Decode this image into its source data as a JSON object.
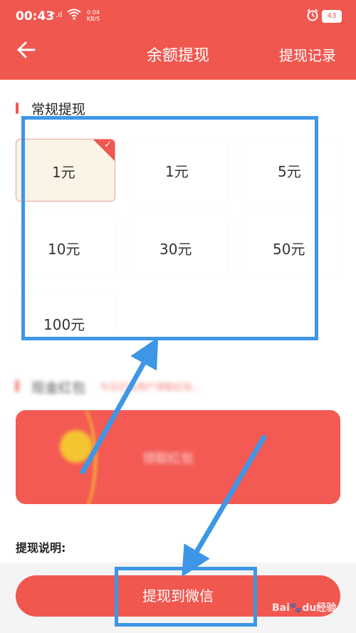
{
  "status_bar": {
    "time": "00:43",
    "signal": "ˣ.ıl",
    "wifi_icon": "wifi-icon",
    "net_speed": "0.04\nKB/S",
    "alarm_icon": "alarm-icon",
    "battery": "43"
  },
  "header": {
    "back_icon": "back-arrow-icon",
    "title": "余额提现",
    "records_label": "提现记录"
  },
  "regular_withdraw": {
    "title": "常规提现",
    "options": [
      {
        "label": "1元",
        "selected": true
      },
      {
        "label": "1元",
        "selected": false
      },
      {
        "label": "5元",
        "selected": false
      },
      {
        "label": "10元",
        "selected": false
      },
      {
        "label": "30元",
        "selected": false
      },
      {
        "label": "50元",
        "selected": false
      },
      {
        "label": "100元",
        "selected": false
      }
    ]
  },
  "cash_redpacket": {
    "title": "现金红包",
    "subtitle": "今日已有用户领取红包…",
    "banner_text": "领取红包"
  },
  "notes_label": "提现说明:",
  "withdraw_button": "提现到微信",
  "watermark": {
    "brand": "Bai",
    "paw": "🐾",
    "suffix": "du",
    "text": "经验"
  },
  "colors": {
    "primary": "#f0574f",
    "annotation": "#3e96e6"
  }
}
